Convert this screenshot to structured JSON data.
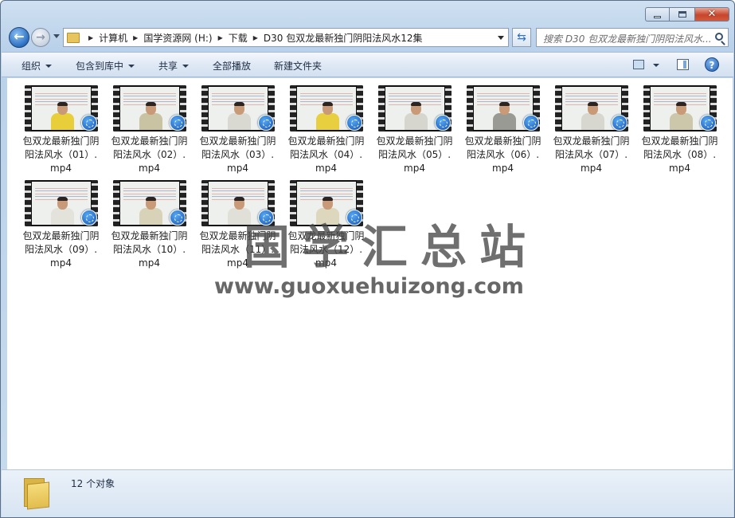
{
  "window": {
    "buttons": {
      "minimize": "minimize-icon",
      "maximize": "maximize-icon",
      "close": "close-icon"
    }
  },
  "address": {
    "crumbs": [
      "计算机",
      "国学资源网 (H:)",
      "下载",
      "D30 包双龙最新独门阴阳法风水12集"
    ]
  },
  "search": {
    "placeholder": "搜索 D30 包双龙最新独门阴阳法风水..."
  },
  "toolbar": {
    "organize": "组织",
    "include_library": "包含到库中",
    "share": "共享",
    "play_all": "全部播放",
    "new_folder": "新建文件夹"
  },
  "files": [
    {
      "name": "包双龙最新独门阴阳法风水（01）.mp4",
      "shirt": "#e8cf3a"
    },
    {
      "name": "包双龙最新独门阴阳法风水（02）.mp4",
      "shirt": "#c9c3a3"
    },
    {
      "name": "包双龙最新独门阴阳法风水（03）.mp4",
      "shirt": "#d9d9d2"
    },
    {
      "name": "包双龙最新独门阴阳法风水（04）.mp4",
      "shirt": "#e7cf40"
    },
    {
      "name": "包双龙最新独门阴阳法风水（05）.mp4",
      "shirt": "#d6d6cf"
    },
    {
      "name": "包双龙最新独门阴阳法风水（06）.mp4",
      "shirt": "#9a9a95"
    },
    {
      "name": "包双龙最新独门阴阳法风水（07）.mp4",
      "shirt": "#d7d7cf"
    },
    {
      "name": "包双龙最新独门阴阳法风水（08）.mp4",
      "shirt": "#ccc6ab"
    },
    {
      "name": "包双龙最新独门阴阳法风水（09）.mp4",
      "shirt": "#e3e3dc"
    },
    {
      "name": "包双龙最新独门阴阳法风水（10）.mp4",
      "shirt": "#d8d3b8"
    },
    {
      "name": "包双龙最新独门阴阳法风水（11）.mp4",
      "shirt": "#e0e0d9"
    },
    {
      "name": "包双龙最新独门阴阳法风水（12）.mp4",
      "shirt": "#dcd7bd"
    }
  ],
  "watermark": {
    "title": "国学汇总站",
    "url": "www.guoxuehuizong.com"
  },
  "status": {
    "count": "12 个对象"
  }
}
